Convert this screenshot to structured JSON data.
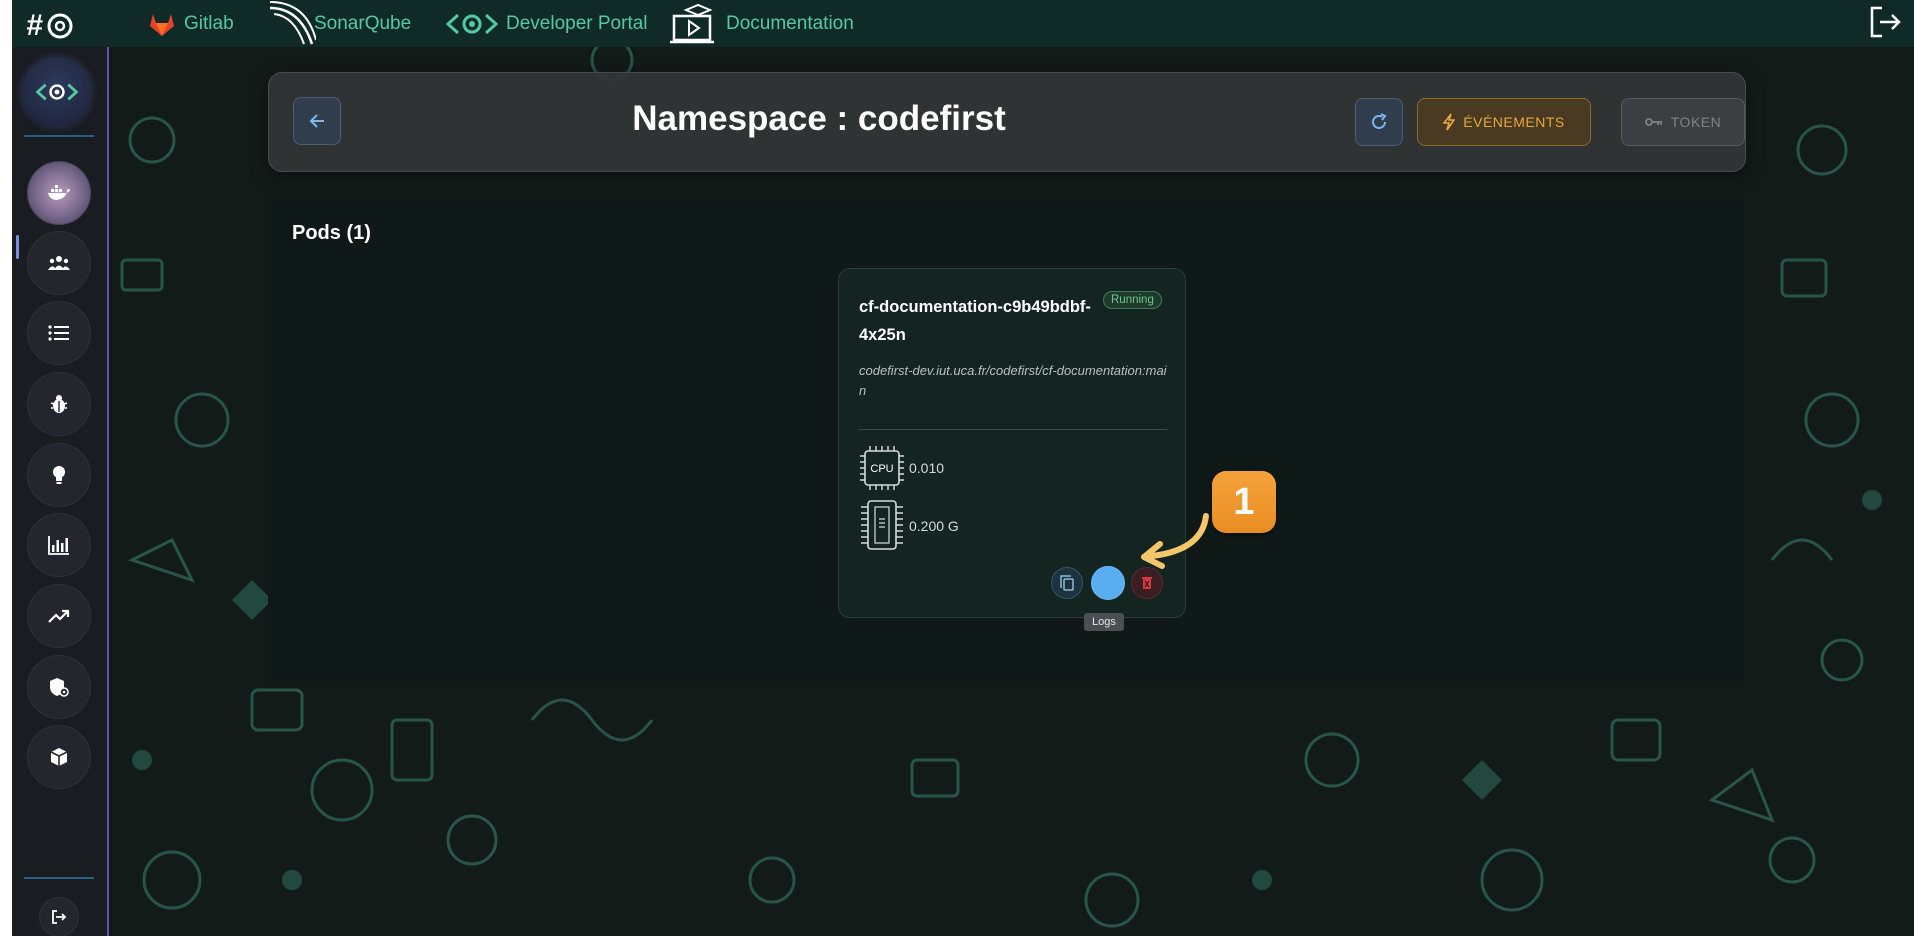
{
  "topbar": {
    "links": [
      {
        "label": "Gitlab",
        "icon": "gitlab-icon"
      },
      {
        "label": "SonarQube",
        "icon": "sonarqube-icon"
      },
      {
        "label": "Developer Portal",
        "icon": "developer-portal-icon"
      },
      {
        "label": "Documentation",
        "icon": "documentation-icon"
      }
    ],
    "accent_color": "#55c8a6"
  },
  "sidebar": {
    "items": [
      {
        "name": "docker",
        "icon": "docker-icon",
        "active": true
      },
      {
        "name": "users",
        "icon": "users-icon"
      },
      {
        "name": "list",
        "icon": "list-icon"
      },
      {
        "name": "bug",
        "icon": "bug-icon"
      },
      {
        "name": "lightbulb",
        "icon": "lightbulb-icon"
      },
      {
        "name": "chart",
        "icon": "bar-chart-icon"
      },
      {
        "name": "trending",
        "icon": "trending-up-icon"
      },
      {
        "name": "security",
        "icon": "shield-icon"
      },
      {
        "name": "package",
        "icon": "cube-icon"
      }
    ],
    "logout_icon": "logout-icon"
  },
  "header": {
    "title": "Namespace : codefirst",
    "events_label": "ÉVÉNEMENTS",
    "token_label": "TOKEN"
  },
  "main": {
    "pods_heading": "Pods (1)",
    "pod": {
      "name": "cf-documentation-c9b49bdbf-4x25n",
      "status": "Running",
      "image": "codefirst-dev.iut.uca.fr/codefirst/cf-documentation:main",
      "cpu_label": "CPU",
      "cpu_value": "0.010",
      "memory_value": "0.200 G",
      "tooltip": "Logs"
    }
  },
  "annotation": {
    "step": "1",
    "color": "#f29a31"
  }
}
